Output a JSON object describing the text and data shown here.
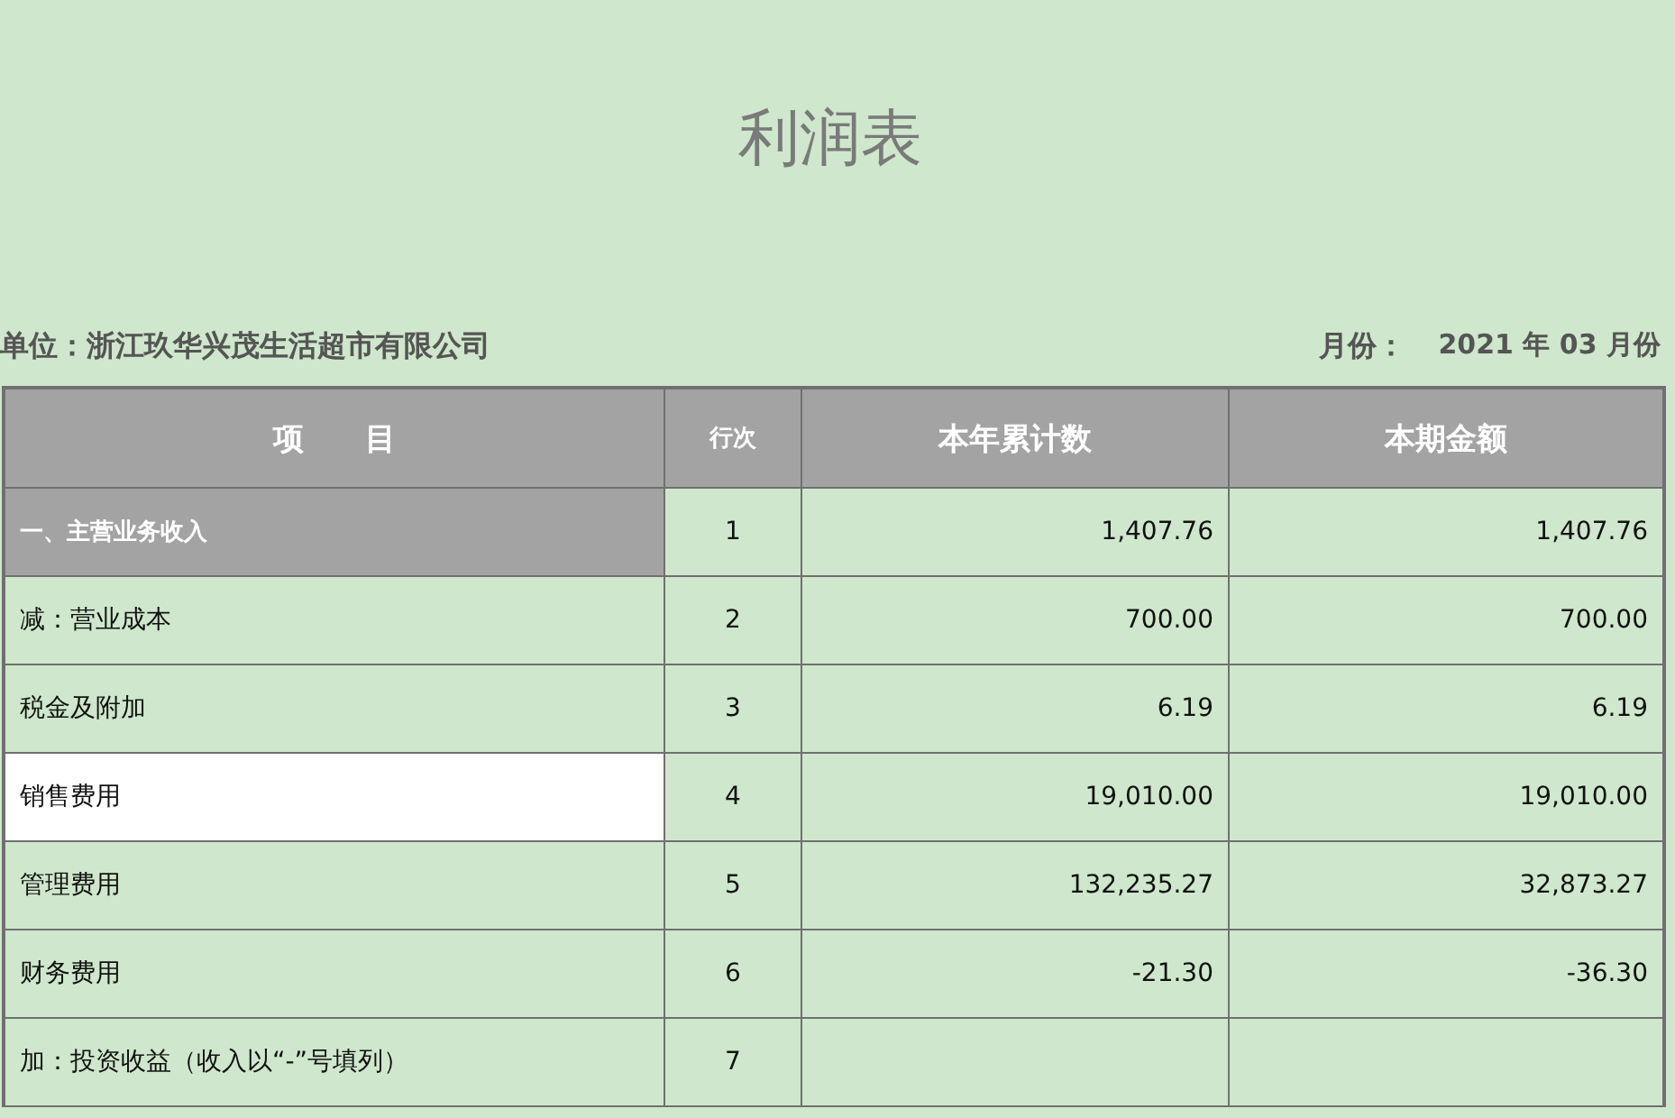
{
  "title": "利润表",
  "unit": "单位：浙江玖华兴茂生活超市有限公司",
  "period": {
    "label": "月份：",
    "value": "2021 年 03 月份"
  },
  "table": {
    "columns": [
      "项　　目",
      "行次",
      "本年累计数",
      "本期金额"
    ],
    "rows": [
      {
        "kind": "section",
        "selected": false,
        "cells": [
          "一、主营业务收入",
          "1",
          "1,407.76",
          "1,407.76"
        ]
      },
      {
        "kind": "line",
        "selected": false,
        "cells": [
          "减：营业成本",
          "2",
          "700.00",
          "700.00"
        ]
      },
      {
        "kind": "line",
        "selected": false,
        "cells": [
          "税金及附加",
          "3",
          "6.19",
          "6.19"
        ]
      },
      {
        "kind": "line",
        "selected": true,
        "cells": [
          "销售费用",
          "4",
          "19,010.00",
          "19,010.00"
        ]
      },
      {
        "kind": "line",
        "selected": false,
        "cells": [
          "管理费用",
          "5",
          "132,235.27",
          "32,873.27"
        ]
      },
      {
        "kind": "line",
        "selected": false,
        "cells": [
          "财务费用",
          "6",
          "-21.30",
          "-36.30"
        ]
      },
      {
        "kind": "line",
        "selected": false,
        "cells": [
          "加：投资收益（收入以“-”号填列）",
          "7",
          "",
          ""
        ]
      }
    ]
  }
}
